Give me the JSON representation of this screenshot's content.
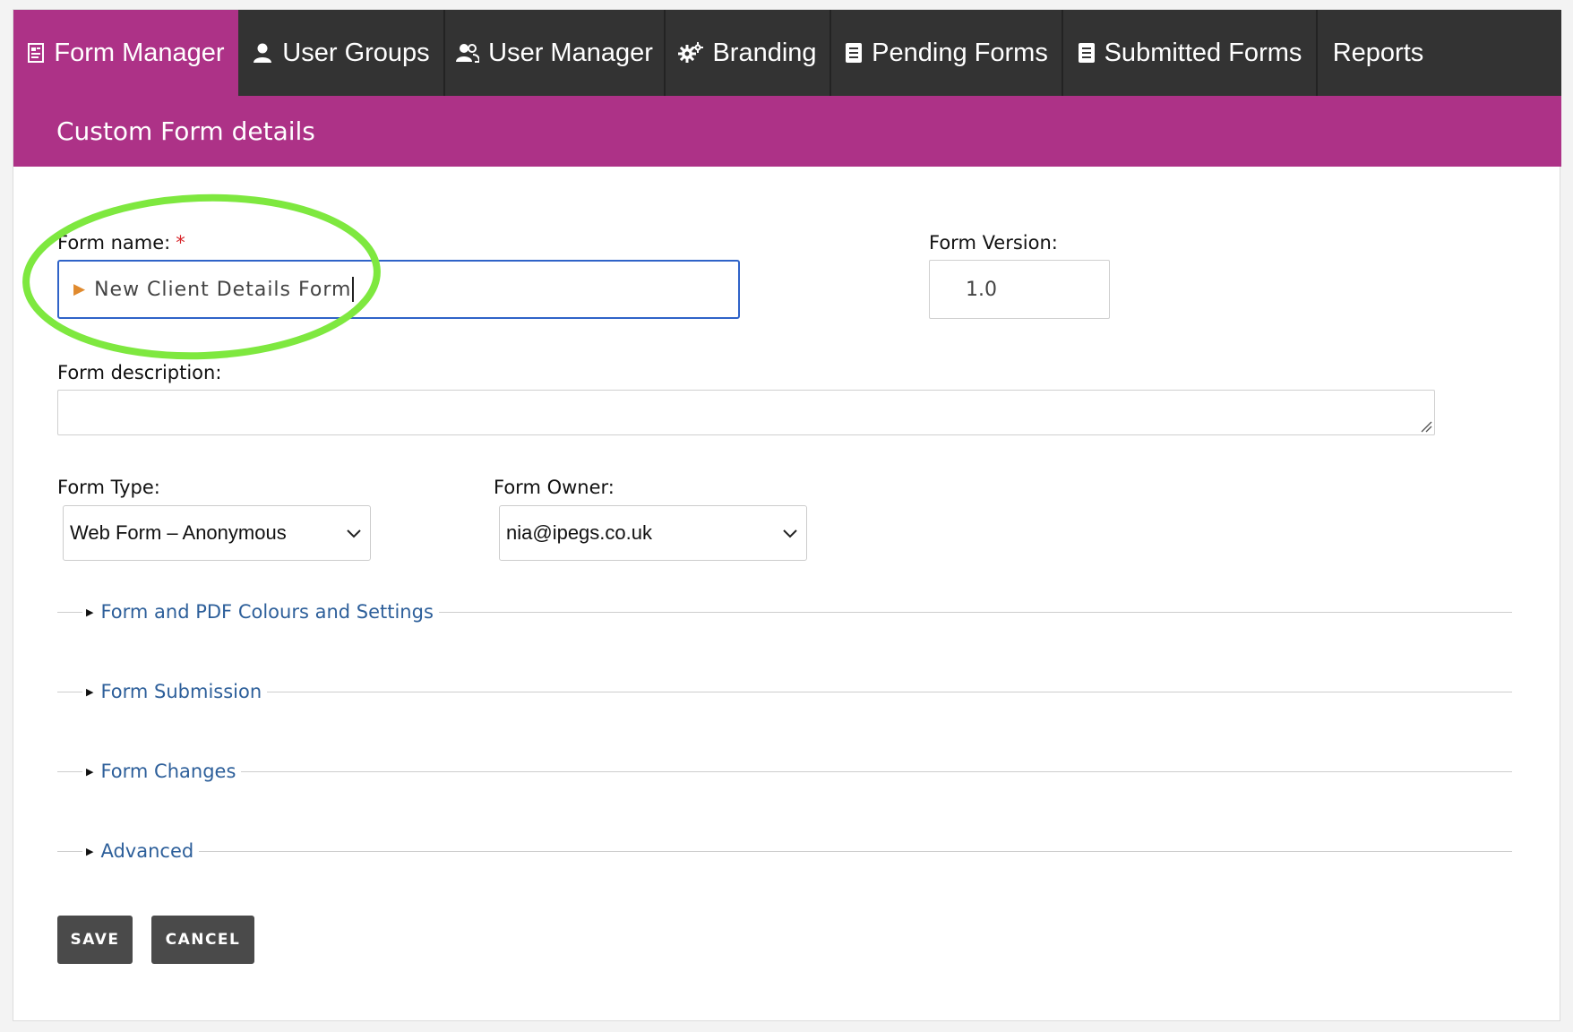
{
  "nav": {
    "tabs": [
      {
        "label": "Form Manager",
        "icon": "form-doc-icon",
        "active": true
      },
      {
        "label": "User Groups",
        "icon": "user-icon",
        "active": false
      },
      {
        "label": "User Manager",
        "icon": "users-icon",
        "active": false
      },
      {
        "label": "Branding",
        "icon": "gears-icon",
        "active": false
      },
      {
        "label": "Pending Forms",
        "icon": "document-icon",
        "active": false
      },
      {
        "label": "Submitted Forms",
        "icon": "document-icon",
        "active": false
      },
      {
        "label": "Reports",
        "icon": "",
        "active": false
      }
    ]
  },
  "header": {
    "title": "Custom Form details"
  },
  "form": {
    "name_label": "Form name:",
    "required_marker": "*",
    "name_value": "New Client Details Form",
    "version_label": "Form Version:",
    "version_value": "1.0",
    "description_label": "Form description:",
    "description_value": "",
    "type_label": "Form Type:",
    "type_value": "Web Form – Anonymous",
    "owner_label": "Form Owner:",
    "owner_value": "nia@ipegs.co.uk"
  },
  "sections": [
    {
      "label": "Form and PDF Colours and Settings"
    },
    {
      "label": "Form Submission"
    },
    {
      "label": "Form Changes"
    },
    {
      "label": "Advanced"
    }
  ],
  "buttons": {
    "save": "SAVE",
    "cancel": "CANCEL"
  },
  "colors": {
    "accent": "#ad3287",
    "nav_background": "#333333",
    "link": "#2d5f9a",
    "focus_border": "#2f63c8",
    "required": "#d8262b",
    "annotation": "#7ee83f"
  }
}
